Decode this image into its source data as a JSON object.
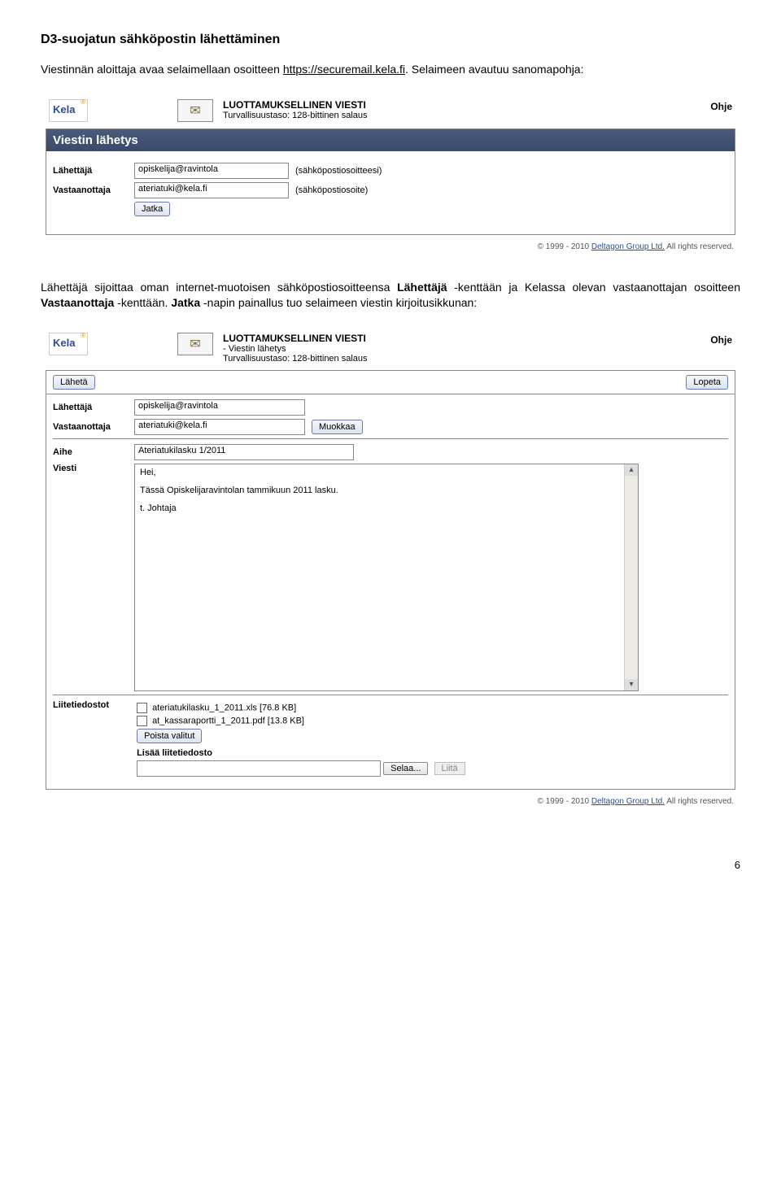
{
  "doc": {
    "section_title": "D3-suojatun sähköpostin lähettäminen",
    "intro_prefix": "Viestinnän aloittaja avaa selaimellaan osoitteen ",
    "intro_link": "https://securemail.kela.fi",
    "intro_suffix": ". Selaimeen avautuu sanomapohja:",
    "after1_p_prefix": "Lähettäjä sijoittaa oman internet-muotoisen sähköpostiosoitteensa ",
    "after1_b1": "Lähettäjä",
    "after1_mid1": " -kenttään ja Kelassa olevan vastaanottajan osoitteen ",
    "after1_b2": "Vastaanottaja",
    "after1_mid2": " -kenttään. ",
    "after1_b3": "Jatka",
    "after1_suffix": " -napin painallus tuo selaimeen viestin kirjoitusikkunan:",
    "pagenum": "6"
  },
  "ui1": {
    "logo": "Kela",
    "conf_title": "LUOTTAMUKSELLINEN VIESTI",
    "sec_level": "Turvallisuustaso: 128-bittinen salaus",
    "help": "Ohje",
    "panel_title": "Viestin lähetys",
    "label_from": "Lähettäjä",
    "label_to": "Vastaanottaja",
    "val_from": "opiskelija@ravintola",
    "val_to": "ateriatuki@kela.fi",
    "after_from": "(sähköpostiosoitteesi)",
    "after_to": "(sähköpostiosoite)",
    "btn_continue": "Jatka",
    "copyright_prefix": "© 1999 - 2010 ",
    "copyright_link": "Deltagon Group Ltd.",
    "copyright_suffix": " All rights reserved."
  },
  "ui2": {
    "logo": "Kela",
    "conf_title": "LUOTTAMUKSELLINEN VIESTI",
    "sub_send": "- Viestin lähetys",
    "sec_level": "Turvallisuustaso: 128-bittinen salaus",
    "help": "Ohje",
    "btn_send": "Lähetä",
    "btn_quit": "Lopeta",
    "label_from": "Lähettäjä",
    "label_to": "Vastaanottaja",
    "label_subject": "Aihe",
    "label_msg": "Viesti",
    "val_from": "opiskelija@ravintola",
    "val_to": "ateriatuki@kela.fi",
    "btn_edit": "Muokkaa",
    "val_subject": "Ateriatukilasku 1/2011",
    "msg_l1": "Hei,",
    "msg_l2": "Tässä Opiskelijaravintolan tammikuun 2011 lasku.",
    "msg_l3": "t. Johtaja",
    "label_attach": "Liitetiedostot",
    "att1": "ateriatukilasku_1_2011.xls [76.8 KB]",
    "att2": "at_kassaraportti_1_2011.pdf [13.8 KB]",
    "btn_remove": "Poista valitut",
    "label_add": "Lisää liitetiedosto",
    "btn_browse": "Selaa...",
    "btn_attach": "Liitä",
    "copyright_prefix": "© 1999 - 2010 ",
    "copyright_link": "Deltagon Group Ltd.",
    "copyright_suffix": " All rights reserved."
  }
}
